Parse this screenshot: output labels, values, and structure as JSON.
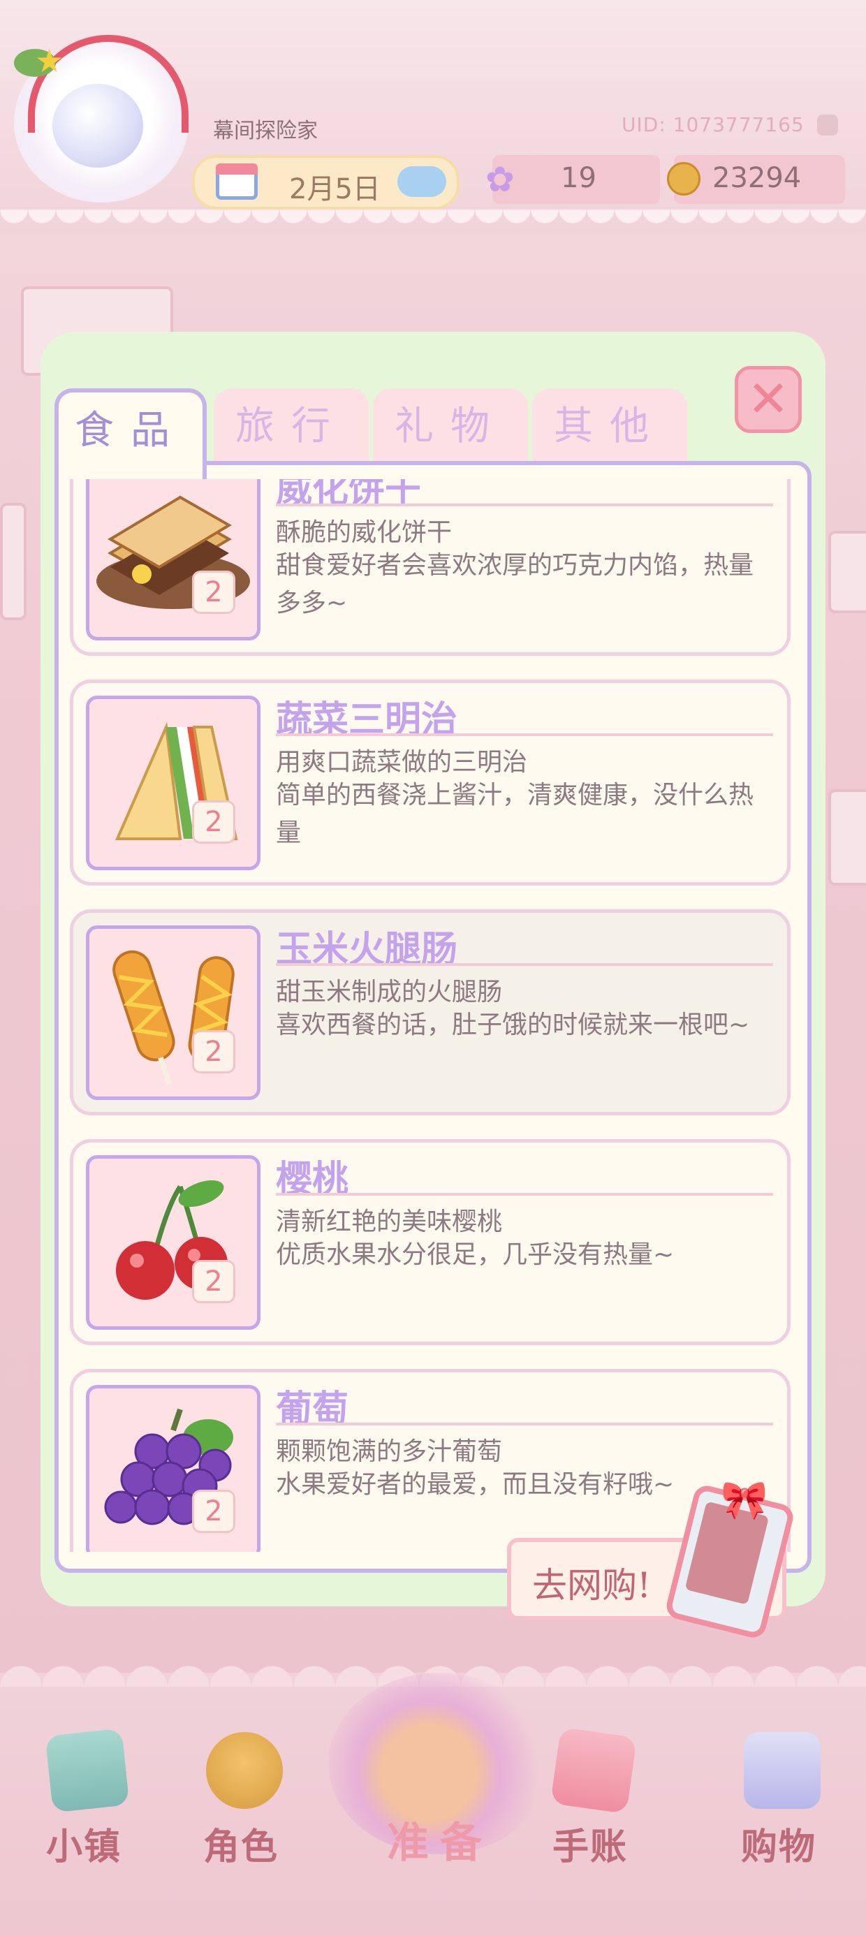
{
  "header": {
    "player_name": "幕间探险家",
    "uid": "UID: 1073777165",
    "date": "2月5日",
    "flower_count": "19",
    "coins": "23294"
  },
  "tabs": [
    {
      "label": "食品",
      "active": true
    },
    {
      "label": "旅行",
      "active": false
    },
    {
      "label": "礼物",
      "active": false
    },
    {
      "label": "其他",
      "active": false
    }
  ],
  "items": [
    {
      "name": "威化饼干",
      "subtitle": "酥脆的威化饼干",
      "description": "甜食爱好者会喜欢浓厚的巧克力内馅，热量多多~",
      "count": "2",
      "icon": "wafer-icon"
    },
    {
      "name": "蔬菜三明治",
      "subtitle": "用爽口蔬菜做的三明治",
      "description": "简单的西餐浇上酱汁，清爽健康，没什么热量",
      "count": "2",
      "icon": "sandwich-icon"
    },
    {
      "name": "玉米火腿肠",
      "subtitle": "甜玉米制成的火腿肠",
      "description": "喜欢西餐的话，肚子饿的时候就来一根吧~",
      "count": "2",
      "icon": "corndog-icon"
    },
    {
      "name": "樱桃",
      "subtitle": "清新红艳的美味樱桃",
      "description": "优质水果水分很足，几乎没有热量~",
      "count": "2",
      "icon": "cherry-icon"
    },
    {
      "name": "葡萄",
      "subtitle": "颗颗饱满的多汁葡萄",
      "description": "水果爱好者的最爱，而且没有籽哦~",
      "count": "2",
      "icon": "grape-icon"
    }
  ],
  "shop_button": {
    "label": "去网购!"
  },
  "close_button": {
    "symbol": "✕"
  },
  "bottom_nav": [
    {
      "label": "小镇",
      "icon": "map-icon"
    },
    {
      "label": "角色",
      "icon": "character-icon"
    },
    {
      "label": "准备",
      "icon": "basket-icon"
    },
    {
      "label": "手账",
      "icon": "journal-icon"
    },
    {
      "label": "购物",
      "icon": "shopping-bag-icon"
    }
  ],
  "colors": {
    "panel_bg": "#e6f6d9",
    "tab_border": "#c6b3ea",
    "item_title": "#c3a4ec",
    "nav_label": "#bd6b79"
  }
}
